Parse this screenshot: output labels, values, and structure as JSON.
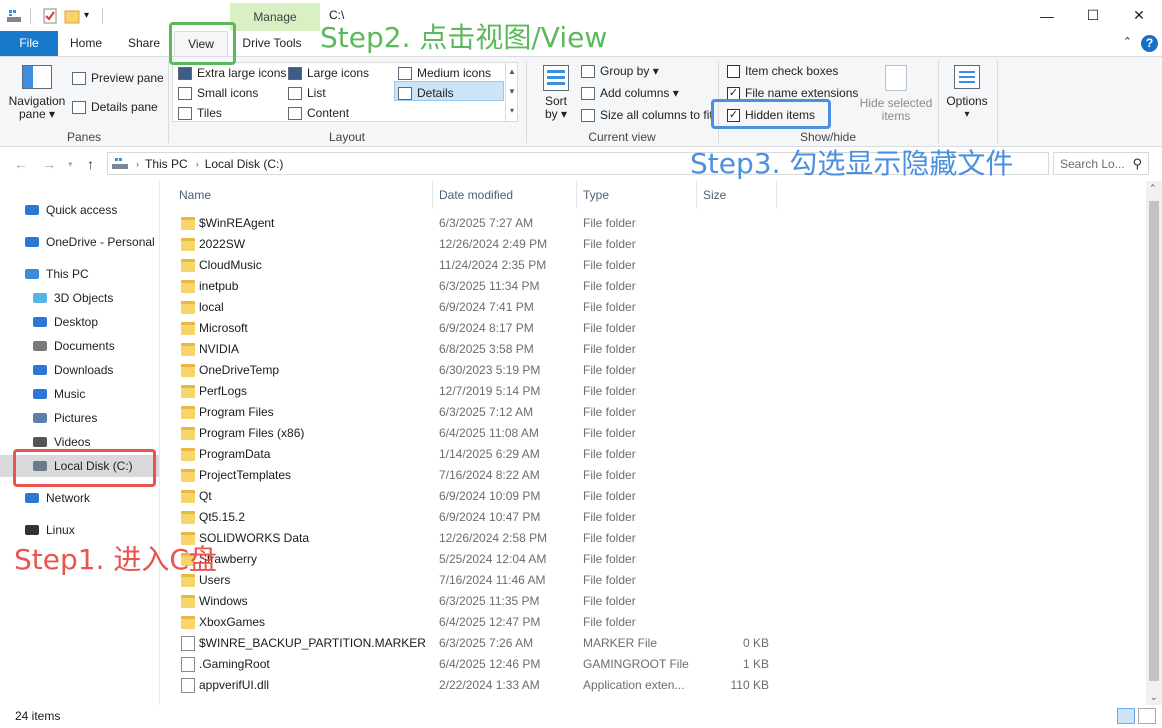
{
  "window": {
    "title": "C:\\",
    "manage_tab": "Manage",
    "minimize": "—",
    "maximize": "☐",
    "close": "✕"
  },
  "tabs": {
    "file": "File",
    "home": "Home",
    "share": "Share",
    "view": "View",
    "drive_tools": "Drive Tools"
  },
  "ribbon": {
    "panes": {
      "label": "Panes",
      "navigation_pane": "Navigation",
      "navigation_pane_2": "pane ▾",
      "preview_pane": "Preview pane",
      "details_pane": "Details pane"
    },
    "layout": {
      "label": "Layout",
      "extra_large_icons": "Extra large icons",
      "large_icons": "Large icons",
      "medium_icons": "Medium icons",
      "small_icons": "Small icons",
      "list": "List",
      "details": "Details",
      "tiles": "Tiles",
      "content": "Content"
    },
    "current_view": {
      "label": "Current view",
      "sort": "Sort",
      "sort_2": "by ▾",
      "group_by": "Group by ▾",
      "add_columns": "Add columns ▾",
      "size_all_columns": "Size all columns to fit"
    },
    "show_hide": {
      "label": "Show/hide",
      "item_check_boxes": "Item check boxes",
      "item_check_boxes_checked": false,
      "file_name_extensions": "File name extensions",
      "file_name_extensions_checked": true,
      "hidden_items": "Hidden items",
      "hidden_items_checked": true,
      "hide_selected": "Hide selected",
      "hide_selected_2": "items"
    },
    "options": {
      "label": "Options",
      "caret": "▾"
    }
  },
  "address": {
    "crumbs": [
      "This PC",
      "Local Disk (C:)"
    ],
    "search_placeholder": "Search Lo..."
  },
  "nav": [
    {
      "label": "Quick access",
      "icon": "star-icon",
      "color": "#2b78d6"
    },
    {
      "label": "OneDrive - Personal",
      "icon": "cloud-icon",
      "color": "#2b78d6"
    },
    {
      "label": "This PC",
      "icon": "computer-icon",
      "color": "#3b8bd9"
    },
    {
      "label": "3D Objects",
      "icon": "cube-icon",
      "color": "#52b5e6"
    },
    {
      "label": "Desktop",
      "icon": "desktop-icon",
      "color": "#2b78d6"
    },
    {
      "label": "Documents",
      "icon": "document-icon",
      "color": "#7a7a7a"
    },
    {
      "label": "Downloads",
      "icon": "download-icon",
      "color": "#2b78d6"
    },
    {
      "label": "Music",
      "icon": "music-icon",
      "color": "#2b78d6"
    },
    {
      "label": "Pictures",
      "icon": "picture-icon",
      "color": "#5a7fa8"
    },
    {
      "label": "Videos",
      "icon": "video-icon",
      "color": "#555555"
    },
    {
      "label": "Local Disk (C:)",
      "icon": "drive-icon",
      "color": "#6a7a8a"
    },
    {
      "label": "Network",
      "icon": "network-icon",
      "color": "#2b78d6"
    },
    {
      "label": "Linux",
      "icon": "linux-icon",
      "color": "#333333"
    }
  ],
  "columns": {
    "name": "Name",
    "date": "Date modified",
    "type": "Type",
    "size": "Size"
  },
  "files": [
    {
      "name": "$WinREAgent",
      "date": "6/3/2025 7:27 AM",
      "type": "File folder",
      "size": "",
      "kind": "folder"
    },
    {
      "name": "2022SW",
      "date": "12/26/2024 2:49 PM",
      "type": "File folder",
      "size": "",
      "kind": "folder"
    },
    {
      "name": "CloudMusic",
      "date": "11/24/2024 2:35 PM",
      "type": "File folder",
      "size": "",
      "kind": "folder"
    },
    {
      "name": "inetpub",
      "date": "6/3/2025 11:34 PM",
      "type": "File folder",
      "size": "",
      "kind": "folder"
    },
    {
      "name": "local",
      "date": "6/9/2024 7:41 PM",
      "type": "File folder",
      "size": "",
      "kind": "folder"
    },
    {
      "name": "Microsoft",
      "date": "6/9/2024 8:17 PM",
      "type": "File folder",
      "size": "",
      "kind": "folder"
    },
    {
      "name": "NVIDIA",
      "date": "6/8/2025 3:58 PM",
      "type": "File folder",
      "size": "",
      "kind": "folder"
    },
    {
      "name": "OneDriveTemp",
      "date": "6/30/2023 5:19 PM",
      "type": "File folder",
      "size": "",
      "kind": "folder"
    },
    {
      "name": "PerfLogs",
      "date": "12/7/2019 5:14 PM",
      "type": "File folder",
      "size": "",
      "kind": "folder"
    },
    {
      "name": "Program Files",
      "date": "6/3/2025 7:12 AM",
      "type": "File folder",
      "size": "",
      "kind": "folder"
    },
    {
      "name": "Program Files (x86)",
      "date": "6/4/2025 11:08 AM",
      "type": "File folder",
      "size": "",
      "kind": "folder"
    },
    {
      "name": "ProgramData",
      "date": "1/14/2025 6:29 AM",
      "type": "File folder",
      "size": "",
      "kind": "folder"
    },
    {
      "name": "ProjectTemplates",
      "date": "7/16/2024 8:22 AM",
      "type": "File folder",
      "size": "",
      "kind": "folder"
    },
    {
      "name": "Qt",
      "date": "6/9/2024 10:09 PM",
      "type": "File folder",
      "size": "",
      "kind": "folder"
    },
    {
      "name": "Qt5.15.2",
      "date": "6/9/2024 10:47 PM",
      "type": "File folder",
      "size": "",
      "kind": "folder"
    },
    {
      "name": "SOLIDWORKS Data",
      "date": "12/26/2024 2:58 PM",
      "type": "File folder",
      "size": "",
      "kind": "folder"
    },
    {
      "name": "Strawberry",
      "date": "5/25/2024 12:04 AM",
      "type": "File folder",
      "size": "",
      "kind": "folder"
    },
    {
      "name": "Users",
      "date": "7/16/2024 11:46 AM",
      "type": "File folder",
      "size": "",
      "kind": "folder"
    },
    {
      "name": "Windows",
      "date": "6/3/2025 11:35 PM",
      "type": "File folder",
      "size": "",
      "kind": "folder"
    },
    {
      "name": "XboxGames",
      "date": "6/4/2025 12:47 PM",
      "type": "File folder",
      "size": "",
      "kind": "folder"
    },
    {
      "name": "$WINRE_BACKUP_PARTITION.MARKER",
      "date": "6/3/2025 7:26 AM",
      "type": "MARKER File",
      "size": "0 KB",
      "kind": "file"
    },
    {
      "name": ".GamingRoot",
      "date": "6/4/2025 12:46 PM",
      "type": "GAMINGROOT File",
      "size": "1 KB",
      "kind": "file"
    },
    {
      "name": "appverifUI.dll",
      "date": "2/22/2024 1:33 AM",
      "type": "Application exten...",
      "size": "110 KB",
      "kind": "dll"
    }
  ],
  "status": {
    "item_count": "24 items"
  },
  "annotations": {
    "step1": "Step1. 进入C盘",
    "step2": "Step2. 点击视图/View",
    "step3": "Step3. 勾选显示隐藏文件",
    "step1_color": "#e8544f",
    "step2_color": "#5cb85c",
    "step3_color": "#4a8fe0"
  },
  "colors": {
    "file_tab": "#1979ca",
    "manage_tab": "#d9f0c5",
    "selection": "#cce4f7",
    "folder": "#f8d56b"
  }
}
